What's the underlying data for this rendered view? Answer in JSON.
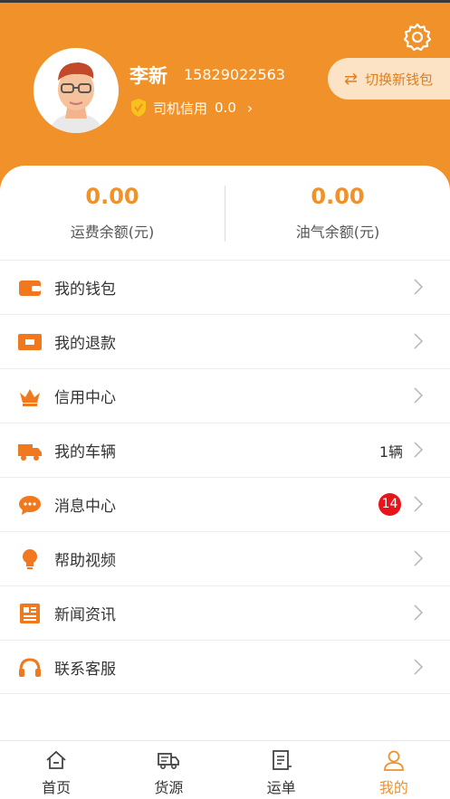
{
  "profile": {
    "name": "李新",
    "phone": "15829022563",
    "credit_label": "司机信用",
    "credit_value": "0.0"
  },
  "header": {
    "switch_wallet_label": "切换新钱包"
  },
  "balances": [
    {
      "amount": "0.00",
      "label": "运费余额(元)"
    },
    {
      "amount": "0.00",
      "label": "油气余额(元)"
    }
  ],
  "menu": [
    {
      "label": "我的钱包",
      "icon": "wallet-icon"
    },
    {
      "label": "我的退款",
      "icon": "refund-card-icon"
    },
    {
      "label": "信用中心",
      "icon": "crown-icon"
    },
    {
      "label": "我的车辆",
      "icon": "truck-icon",
      "right_text": "1辆"
    },
    {
      "label": "消息中心",
      "icon": "chat-bubble-icon",
      "badge": "14"
    },
    {
      "label": "帮助视频",
      "icon": "lightbulb-icon"
    },
    {
      "label": "新闻资讯",
      "icon": "newspaper-icon"
    },
    {
      "label": "联系客服",
      "icon": "headset-icon"
    }
  ],
  "tabs": [
    {
      "label": "首页",
      "icon": "home-icon",
      "active": false
    },
    {
      "label": "货源",
      "icon": "cargo-truck-icon",
      "active": false
    },
    {
      "label": "运单",
      "icon": "waybill-icon",
      "active": false
    },
    {
      "label": "我的",
      "icon": "person-icon",
      "active": true
    }
  ],
  "colors": {
    "accent": "#f0912a",
    "switch_bg": "#fde3c6",
    "badge": "#e8141a"
  }
}
